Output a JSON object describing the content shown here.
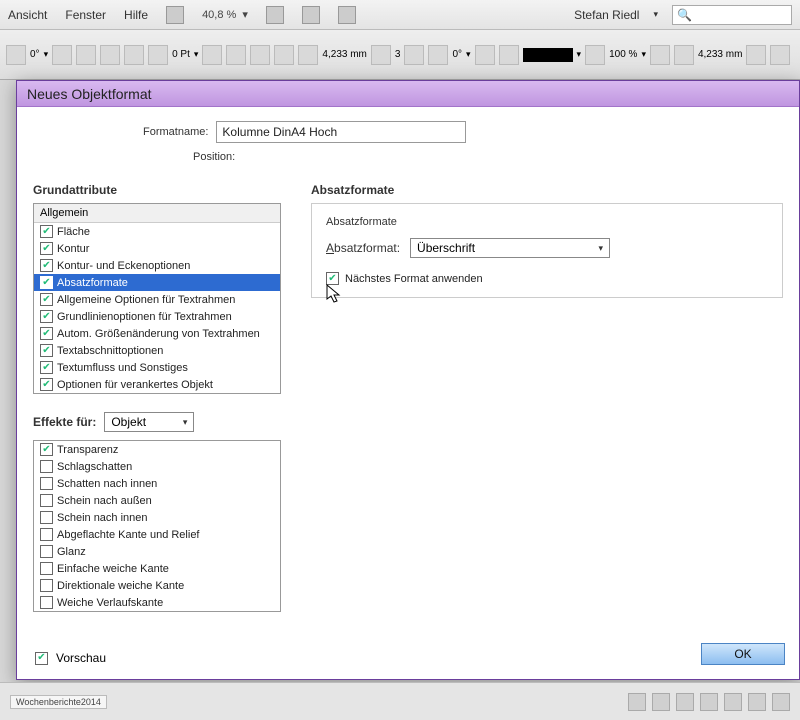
{
  "menubar": {
    "items": [
      "Ansicht",
      "Fenster",
      "Hilfe"
    ],
    "zoom": "40,8 %",
    "user": "Stefan Riedl"
  },
  "dialog": {
    "title": "Neues Objektformat",
    "formatname_label": "Formatname:",
    "formatname_value": "Kolumne DinA4 Hoch",
    "position_label": "Position:",
    "grund_title": "Grundattribute",
    "allgemein_header": "Allgemein",
    "grund_items": [
      "Fläche",
      "Kontur",
      "Kontur- und Eckenoptionen",
      "Absatzformate",
      "Allgemeine Optionen für Textrahmen",
      "Grundlinienoptionen für Textrahmen",
      "Autom. Größenänderung von Textrahmen",
      "Textabschnittoptionen",
      "Textumfluss und Sonstiges",
      "Optionen für verankertes Objekt"
    ],
    "grund_selected_index": 3,
    "effects_label": "Effekte für:",
    "effects_target": "Objekt",
    "effects_items": [
      {
        "label": "Transparenz",
        "on": true
      },
      {
        "label": "Schlagschatten",
        "on": false
      },
      {
        "label": "Schatten nach innen",
        "on": false
      },
      {
        "label": "Schein nach außen",
        "on": false
      },
      {
        "label": "Schein nach innen",
        "on": false
      },
      {
        "label": "Abgeflachte Kante und Relief",
        "on": false
      },
      {
        "label": "Glanz",
        "on": false
      },
      {
        "label": "Einfache weiche Kante",
        "on": false
      },
      {
        "label": "Direktionale weiche Kante",
        "on": false
      },
      {
        "label": "Weiche Verlaufskante",
        "on": false
      }
    ],
    "absatz_title": "Absatzformate",
    "absatz_box_title": "Absatzformate",
    "absatz_label": "Absatzformat:",
    "absatz_value": "Überschrift",
    "next_format_label": "Nächstes Format anwenden",
    "vorschau_label": "Vorschau",
    "ok_label": "OK"
  },
  "toolbar": {
    "stroke": "0 Pt",
    "zoom2": "100 %",
    "w1": "4,233 mm",
    "w2": "4,233 mm",
    "cols": "3",
    "ang1": "0°",
    "ang2": "0°"
  },
  "bottom": {
    "tab": "Wochenberichte2014"
  }
}
